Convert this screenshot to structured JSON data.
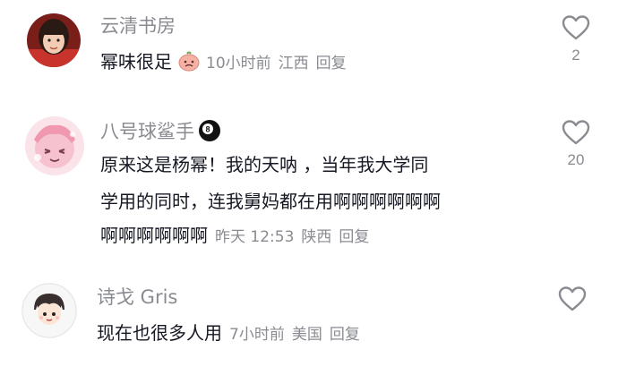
{
  "comments": [
    {
      "username": "云清书房",
      "text": "幂味很足",
      "time": "10小时前",
      "location": "江西",
      "reply_label": "回复",
      "likes": "2",
      "avatar_icon": "girl-photo-avatar",
      "emoji_icon": "peach-sticker-icon"
    },
    {
      "username": "八号球鲨手",
      "line1": "原来这是杨幂！我的天呐 ，当年我大学同",
      "line2": "学用的同时，连我舅妈都在用啊啊啊啊啊啊",
      "line3": "啊啊啊啊啊啊",
      "time": "昨天 12:53",
      "location": "陕西",
      "reply_label": "回复",
      "likes": "20",
      "avatar_icon": "pink-cartoon-avatar",
      "badge_icon": "eight-ball-icon"
    },
    {
      "username": "诗戈 Gris",
      "text": "现在也很多人用",
      "time": "7小时前",
      "location": "美国",
      "reply_label": "回复",
      "likes": "",
      "avatar_icon": "cartoon-boy-avatar"
    }
  ],
  "colors": {
    "text": "#161823",
    "muted": "#8a8b91",
    "heart_outline": "#8a8b91"
  }
}
